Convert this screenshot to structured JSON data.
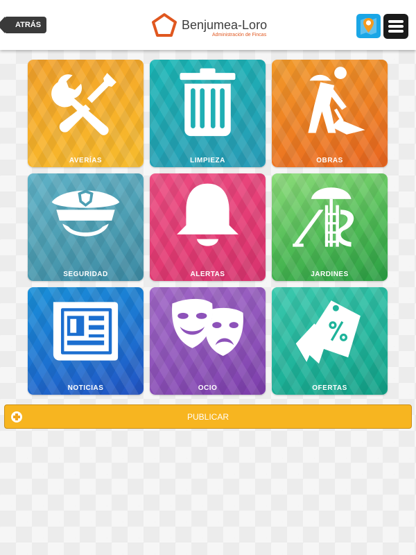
{
  "header": {
    "back_label": "ATRÁS",
    "logo_name": "Benjumea-Loro",
    "logo_subtitle": "Administración de Fincas",
    "map_icon": "map-pin-icon",
    "menu_icon": "hamburger-menu-icon"
  },
  "tiles": [
    {
      "label": "AVERÍAS",
      "icon": "wrench-screwdriver-icon",
      "color": "#f5ac2a"
    },
    {
      "label": "LIMPIEZA",
      "icon": "trash-bin-icon",
      "color": "#1db0b5"
    },
    {
      "label": "OBRAS",
      "icon": "worker-shovel-icon",
      "color": "#ee7e22"
    },
    {
      "label": "SEGURIDAD",
      "icon": "police-cap-icon",
      "color": "#4d9fb4"
    },
    {
      "label": "ALERTAS",
      "icon": "bell-icon",
      "color": "#e33a73"
    },
    {
      "label": "JARDINES",
      "icon": "playground-slide-icon",
      "color": "#3fae4d"
    },
    {
      "label": "NOTICIAS",
      "icon": "newspaper-icon",
      "color": "#1c6fd0"
    },
    {
      "label": "OCIO",
      "icon": "theater-masks-icon",
      "color": "#8d52b9"
    },
    {
      "label": "OFERTAS",
      "icon": "discount-tag-icon",
      "color": "#1fb39a"
    }
  ],
  "publish": {
    "label": "PUBLICAR",
    "icon": "plus-circle-icon",
    "color": "#f7b520"
  },
  "brand": {
    "accent": "#e0571f"
  }
}
